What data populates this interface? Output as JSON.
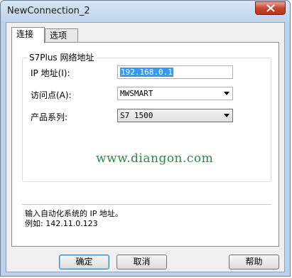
{
  "window": {
    "title": "NewConnection_2"
  },
  "tabs": [
    {
      "label": "连接",
      "active": true
    },
    {
      "label": "选项",
      "active": false
    }
  ],
  "group": {
    "title": "S7Plus 网络地址",
    "ip_label": "IP 地址(I):",
    "ip_value": "192.168.0.1",
    "access_label": "访问点(A):",
    "access_value": "MWSMART",
    "series_label": "产品系列:",
    "series_value": "S7 1500"
  },
  "watermark": "www.diangon.com",
  "hint": {
    "line1": "输入自动化系统的 IP 地址。",
    "line2": "例如: 142.11.0.123"
  },
  "buttons": {
    "ok": "确定",
    "cancel": "取消",
    "help": "帮助"
  },
  "colors": {
    "selection": "#3399ff",
    "watermark": "#2b8a4a",
    "close": "#c7462f"
  }
}
